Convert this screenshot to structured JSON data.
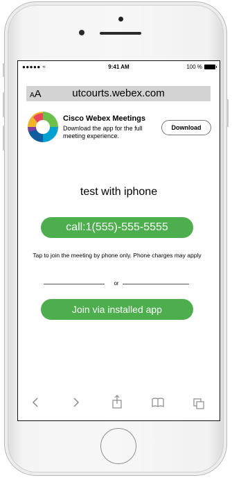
{
  "status_bar": {
    "signal": "●●●●● ",
    "time": "9:41 AM",
    "battery_percent": "100 %"
  },
  "url_bar": {
    "text_size_small": "A",
    "text_size_large": "A",
    "url": "utcourts.webex.com"
  },
  "app_banner": {
    "icon": "webex-logo-icon",
    "name": "Cisco Webex Meetings",
    "description": "Download the app for the full meeting experience.",
    "download_label": "Download"
  },
  "meeting": {
    "title": "test with iphone",
    "call_label": "call:1(555)-555-5555",
    "tap_note": "Tap to join the meeting by phone only. Phone charges may apply",
    "or_label": "or",
    "join_label": "Join via installed app"
  },
  "toolbar": {
    "icons": [
      "back-icon",
      "forward-icon",
      "share-icon",
      "bookmarks-icon",
      "tabs-icon"
    ]
  },
  "colors": {
    "accent_green": "#4cae4c",
    "url_bar_bg": "#d3d3d3"
  }
}
